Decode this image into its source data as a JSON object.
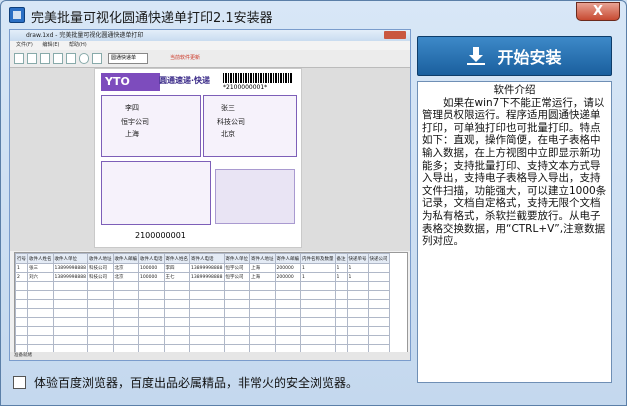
{
  "window": {
    "title": "完美批量可视化圆通快递单打印2.1安装器",
    "close_label": "X"
  },
  "preview": {
    "title": "draw.1xd - 完美批量可视化圆通快递单打印",
    "menu": [
      "文件(F)",
      "编辑(E)",
      "帮助(H)"
    ],
    "select_value": "圆通快递单",
    "tip": "当前软件更新",
    "waybill": {
      "logo": "YTO",
      "brand": "圆通速递·快递",
      "top_number": "*2100000001*",
      "sender_lines": [
        "李四",
        "恒宇公司",
        "上海"
      ],
      "receiver_lines": [
        "张三",
        "科技公司",
        "北京"
      ],
      "bottom_number": "2100000001"
    },
    "grid": {
      "headers": [
        "行号",
        "收件人姓名",
        "收件人单位",
        "收件人地址",
        "收件人邮编",
        "收件人电话",
        "寄件人姓名",
        "寄件人电话",
        "寄件人单位",
        "寄件人地址",
        "寄件人邮编",
        "内件名称及数量",
        "备注",
        "快递单号",
        "快递公司"
      ],
      "rows": [
        [
          "1",
          "张三",
          "13899998888",
          "科技公司",
          "北京",
          "100000",
          "李四",
          "13899998888",
          "恒宇公司",
          "上海",
          "200000",
          "1",
          "1",
          "1",
          ""
        ],
        [
          "2",
          "刘六",
          "13899998888",
          "科技公司",
          "北京",
          "100000",
          "王七",
          "13899998888",
          "恒宇公司",
          "上海",
          "200000",
          "1",
          "1",
          "1",
          ""
        ]
      ],
      "empty_rows": 12
    },
    "status": "准备就绪"
  },
  "install_button": {
    "label": "开始安装"
  },
  "intro": {
    "title": "软件介绍",
    "body": "如果在win7下不能正常运行，请以管理员权限运行。程序适用圆通快递单打印，可单独打印也可批量打印。特点如下：直观，操作简便，在电子表格中输入数据，在上方视图中立即显示新功能多；支持批量打印、支持文本方式导入导出，支持电子表格导入导出，支持文件扫描，功能强大，可以建立1000条记录，文档自定格式，支持无限个文档为私有格式，杀软拦截要放行。从电子表格交换数据，用“CTRL+V”,注意数据列对应。"
  },
  "bottom": {
    "checkbox_label": "体验百度浏览器，百度出品必属精品，非常火的安全浏览器。",
    "checked": false
  }
}
